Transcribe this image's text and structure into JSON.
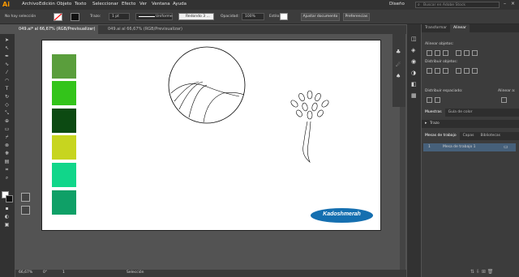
{
  "app": {
    "logo": "Ai",
    "menus": [
      "Archivo",
      "Edición",
      "Objeto",
      "Texto",
      "Seleccionar",
      "Efecto",
      "Ver",
      "Ventana",
      "Ayuda"
    ],
    "workspace": "Diseño",
    "search_placeholder": "Buscar en Adobe Stock"
  },
  "control": {
    "selection": "No hay selección",
    "trazo_label": "Trazo:",
    "stroke_weight": "1 pt",
    "profile": "Uniforme",
    "brush": "Redondo 3 ...",
    "opacity_label": "Opacidad:",
    "opacity": "100%",
    "style_label": "Estilo:",
    "doc_setup": "Ajustar documento",
    "prefs": "Preferencias"
  },
  "tabs": [
    {
      "label": "049.ai* al 66,67% (RGB/Previsualizar)",
      "active": true
    },
    {
      "label": "049.ai al 66,67% (RGB/Previsualizar)",
      "active": false
    }
  ],
  "artwork": {
    "swatches": [
      "#5a9e3c",
      "#33c41a",
      "#0c4a12",
      "#c7d51f",
      "#11d68a",
      "#0fa067"
    ],
    "brand_text": "Kadoshmerah",
    "brand_color": "#156fb0"
  },
  "status": {
    "zoom": "66,67%",
    "rotation": "0°",
    "page": "1",
    "mode": "Selección"
  },
  "panel": {
    "top_tabs": [
      "Transformar",
      "Alinear"
    ],
    "align_objects": "Alinear objetos:",
    "distribute_objects": "Distribuir objetos:",
    "distribute_spacing": "Distribuir espaciado:",
    "align_to": "Alinear a:",
    "swatch_tabs": [
      "Muestras",
      "Guía de color"
    ],
    "stroke_section": "Trazo",
    "board_tabs": [
      "Mesas de trabajo",
      "Capas",
      "Bibliotecas"
    ],
    "artboards": [
      {
        "num": "1",
        "name": "Mesa de trabajo 1"
      }
    ]
  }
}
